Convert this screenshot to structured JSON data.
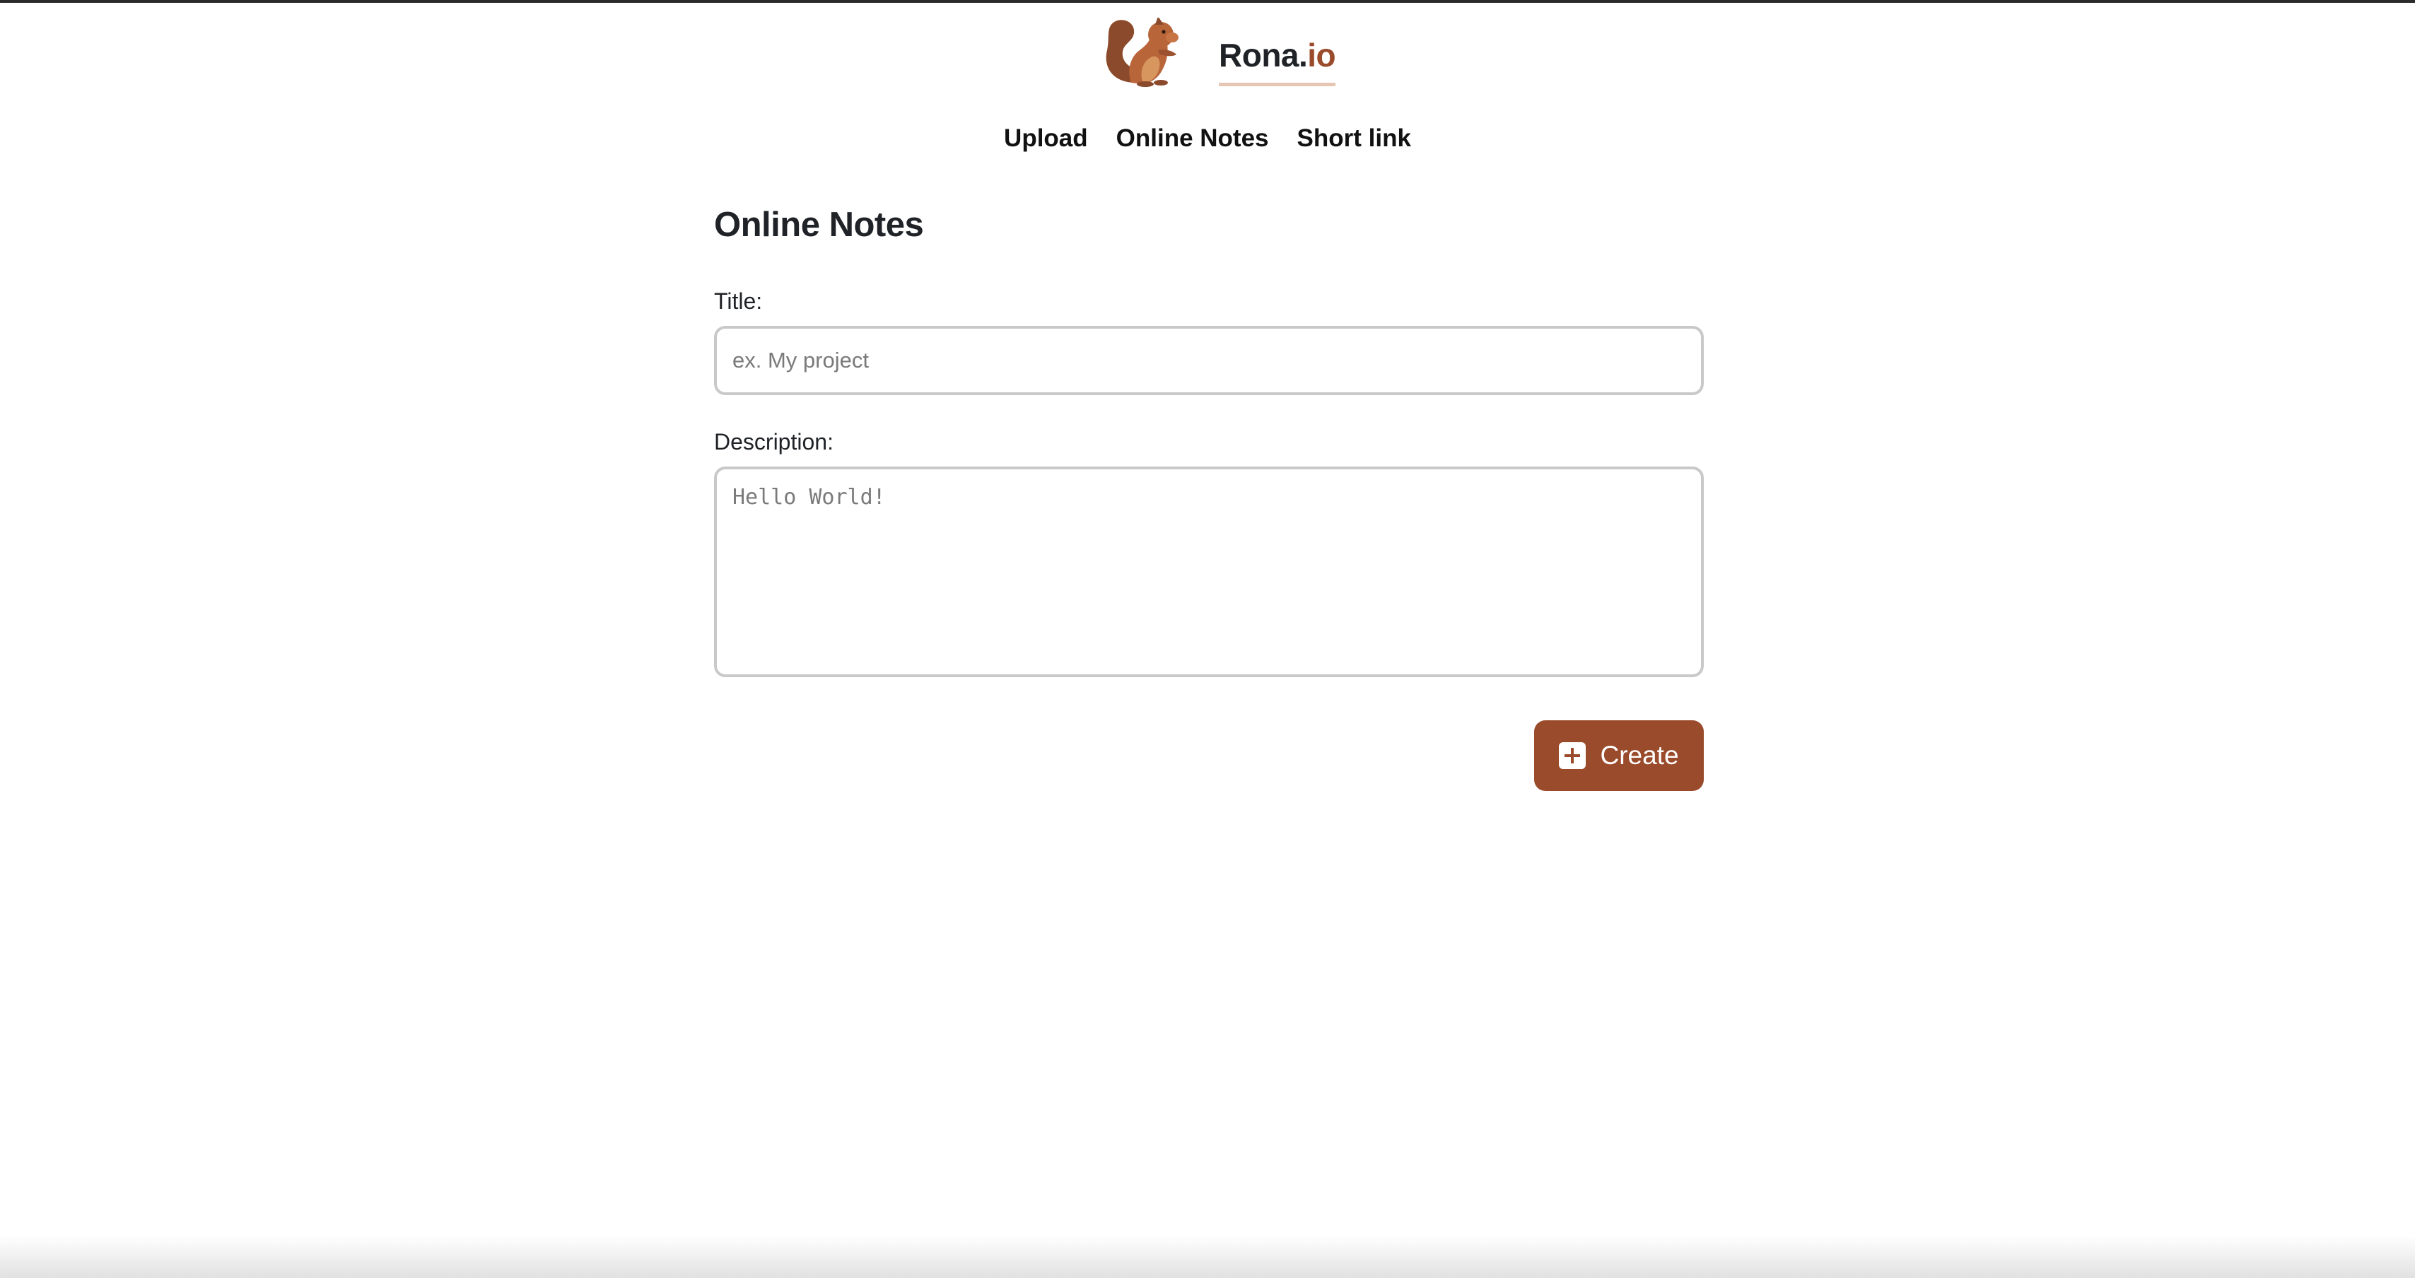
{
  "header": {
    "brand_main": "Rona.",
    "brand_suffix": "io",
    "logo_icon": "squirrel-icon",
    "brand_color": "#9a4b2b",
    "underline_color": "#e6c6b2"
  },
  "nav": {
    "items": [
      {
        "label": "Upload"
      },
      {
        "label": "Online Notes"
      },
      {
        "label": "Short link"
      }
    ]
  },
  "form": {
    "heading": "Online Notes",
    "title_label": "Title:",
    "title_placeholder": "ex. My project",
    "title_value": "",
    "description_label": "Description:",
    "description_placeholder": "Hello World!",
    "description_value": "",
    "create_label": "Create",
    "create_icon": "plus-square-icon"
  }
}
